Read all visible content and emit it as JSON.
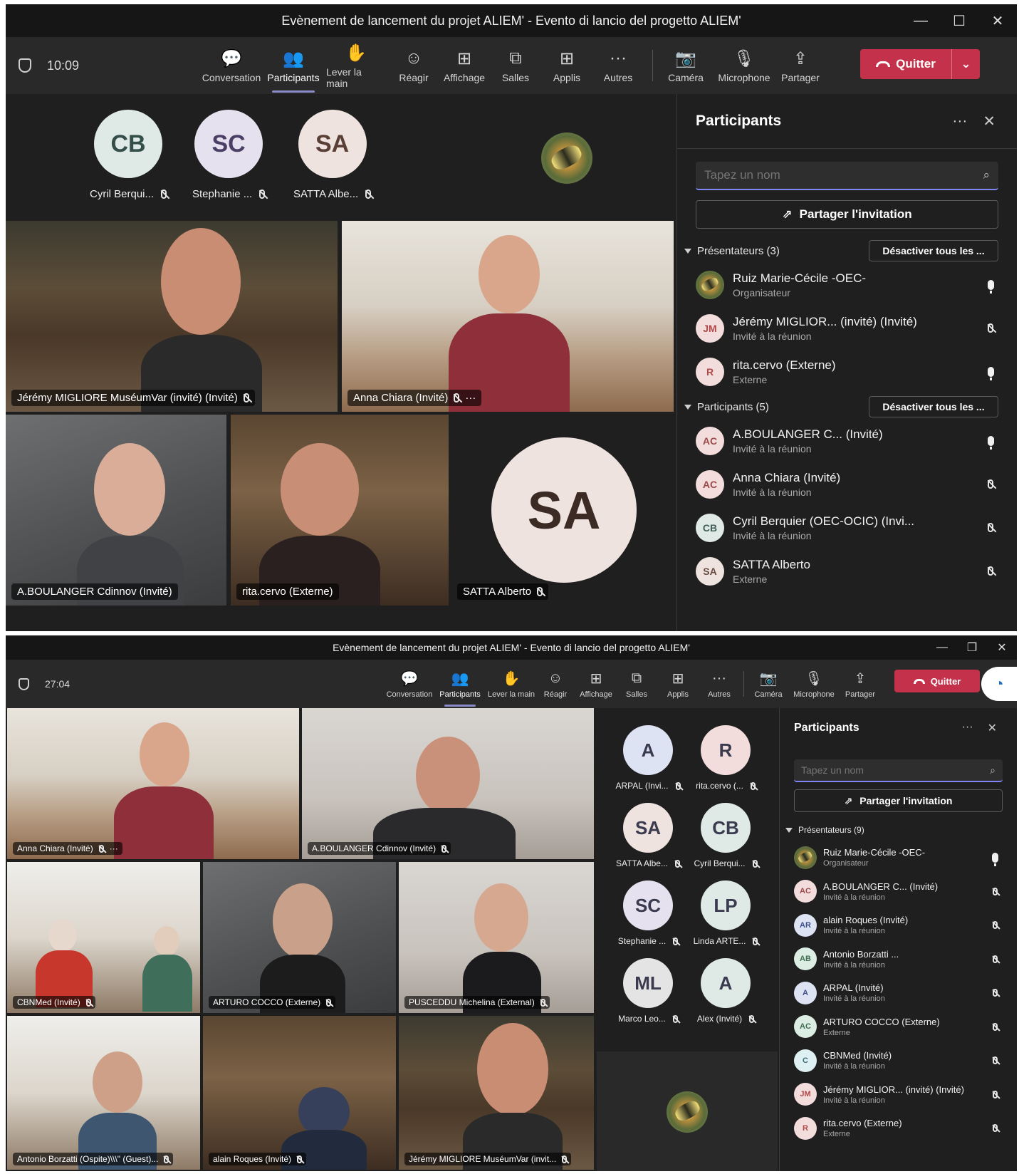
{
  "top": {
    "title": "Evènement de lancement du projet ALIEM' - Evento di lancio del progetto ALIEM'",
    "time": "10:09",
    "toolbar": [
      "Conversation",
      "Participants",
      "Lever la main",
      "Réagir",
      "Affichage",
      "Salles",
      "Applis",
      "Autres",
      "Caméra",
      "Microphone",
      "Partager"
    ],
    "quit": "Quitter",
    "avatars": [
      {
        "initials": "CB",
        "name": "Cyril Berqui...",
        "color": "#dfe9e6"
      },
      {
        "initials": "SC",
        "name": "Stephanie ...",
        "color": "#e6e1ee"
      },
      {
        "initials": "SA",
        "name": "SATTA Albe...",
        "color": "#eee3df"
      }
    ],
    "tiles": [
      {
        "name": "Jérémy MIGLIORE MuséumVar (invité) (Invité)",
        "more": ""
      },
      {
        "name": "Anna Chiara (Invité)",
        "more": "···"
      },
      {
        "name": "A.BOULANGER Cdinnov (Invité)",
        "more": ""
      },
      {
        "name": "rita.cervo (Externe)",
        "more": ""
      },
      {
        "name": "SATTA Alberto",
        "initials": "SA"
      }
    ],
    "panel": {
      "title": "Participants",
      "search_placeholder": "Tapez un nom",
      "invite": "Partager l'invitation",
      "presenters_label": "Présentateurs (3)",
      "attendees_label": "Participants (5)",
      "mute_all": "Désactiver tous les ...",
      "presenters": [
        {
          "initials": "",
          "name": "Ruiz Marie-Cécile -OEC-",
          "role": "Organisateur",
          "mic": "on",
          "avatar": "photo"
        },
        {
          "initials": "JM",
          "name": "Jérémy MIGLIOR... (invité) (Invité)",
          "role": "Invité à la réunion",
          "mic": "off",
          "color": "#f3dcdc",
          "text": "#b04a4a"
        },
        {
          "initials": "R",
          "name": "rita.cervo (Externe)",
          "role": "Externe",
          "mic": "on",
          "color": "#f3dcdc",
          "text": "#b04a4a"
        }
      ],
      "attendees": [
        {
          "initials": "AC",
          "name": "A.BOULANGER C... (Invité)",
          "role": "Invité à la réunion",
          "mic": "on",
          "color": "#f3dcdc",
          "text": "#9c4a4a"
        },
        {
          "initials": "AC",
          "name": "Anna Chiara (Invité)",
          "role": "Invité à la réunion",
          "mic": "off",
          "color": "#f3dcdc",
          "text": "#9c4a4a"
        },
        {
          "initials": "CB",
          "name": "Cyril Berquier (OEC-OCIC) (Invi...",
          "role": "Invité à la réunion",
          "mic": "off",
          "color": "#dfe9e6",
          "text": "#3f5f58"
        },
        {
          "initials": "SA",
          "name": "SATTA Alberto",
          "role": "Externe",
          "mic": "off",
          "color": "#eee3df",
          "text": "#6b4b40"
        }
      ]
    }
  },
  "bottom": {
    "title": "Evènement de lancement du projet ALIEM' - Evento di lancio del progetto ALIEM'",
    "time": "27:04",
    "toolbar": [
      "Conversation",
      "Participants",
      "Lever la main",
      "Réagir",
      "Affichage",
      "Salles",
      "Applis",
      "Autres",
      "Caméra",
      "Microphone",
      "Partager"
    ],
    "quit": "Quitter",
    "tiles": [
      {
        "name": "Anna Chiara (Invité)",
        "more": "···"
      },
      {
        "name": "A.BOULANGER Cdinnov (Invité)",
        "more": ""
      },
      {
        "name": "CBNMed (Invité)",
        "more": ""
      },
      {
        "name": "ARTURO COCCO (Externe)",
        "more": ""
      },
      {
        "name": "PUSCEDDU Michelina (External)",
        "more": ""
      },
      {
        "name": "Antonio Borzatti (Ospite)\\\\\\\" (Guest)...",
        "more": ""
      },
      {
        "name": "alain Roques (Invité)",
        "more": ""
      },
      {
        "name": "Jérémy MIGLIORE MuséumVar (invit...",
        "more": ""
      }
    ],
    "avatars": [
      {
        "initials": "A",
        "name": "ARPAL (Invi...",
        "color": "#dde3f3"
      },
      {
        "initials": "R",
        "name": "rita.cervo (...",
        "color": "#f3dcdc"
      },
      {
        "initials": "SA",
        "name": "SATTA Albe...",
        "color": "#eee3df"
      },
      {
        "initials": "CB",
        "name": "Cyril Berqui...",
        "color": "#dfe9e6"
      },
      {
        "initials": "SC",
        "name": "Stephanie ...",
        "color": "#e6e1ee"
      },
      {
        "initials": "LP",
        "name": "Linda ARTE...",
        "color": "#dfe9e6"
      },
      {
        "initials": "ML",
        "name": "Marco Leo...",
        "color": "#e4e4e4"
      },
      {
        "initials": "A",
        "name": "Alex (Invité)",
        "color": "#dfe9e6"
      }
    ],
    "panel": {
      "title": "Participants",
      "search_placeholder": "Tapez un nom",
      "invite": "Partager l'invitation",
      "presenters_label": "Présentateurs (9)",
      "presenters": [
        {
          "initials": "",
          "name": "Ruiz Marie-Cécile -OEC-",
          "role": "Organisateur",
          "mic": "on",
          "avatar": "photo"
        },
        {
          "initials": "AC",
          "name": "A.BOULANGER C... (Invité)",
          "role": "Invité à la réunion",
          "mic": "off",
          "color": "#f3dcdc",
          "text": "#9c4a4a"
        },
        {
          "initials": "AR",
          "name": "alain Roques (Invité)",
          "role": "Invité à la réunion",
          "mic": "off",
          "color": "#dde3f3",
          "text": "#3d4f8a"
        },
        {
          "initials": "AB",
          "name": "Antonio Borzatti ...",
          "role": "Invité à la réunion",
          "mic": "off",
          "color": "#dceee3",
          "text": "#3f6e52"
        },
        {
          "initials": "A",
          "name": "ARPAL (Invité)",
          "role": "Invité à la réunion",
          "mic": "off",
          "color": "#dde3f3",
          "text": "#3d4f8a"
        },
        {
          "initials": "AC",
          "name": "ARTURO COCCO (Externe)",
          "role": "Externe",
          "mic": "off",
          "color": "#dceee3",
          "text": "#3f6e52"
        },
        {
          "initials": "C",
          "name": "CBNMed (Invité)",
          "role": "Invité à la réunion",
          "mic": "off",
          "color": "#dff0f3",
          "text": "#3f6e78"
        },
        {
          "initials": "JM",
          "name": "Jérémy MIGLIOR... (invité) (Invité)",
          "role": "Invité à la réunion",
          "mic": "off",
          "color": "#f3dcdc",
          "text": "#b04a4a"
        },
        {
          "initials": "R",
          "name": "rita.cervo (Externe)",
          "role": "Externe",
          "mic": "off",
          "color": "#f3dcdc",
          "text": "#b04a4a"
        }
      ]
    }
  }
}
